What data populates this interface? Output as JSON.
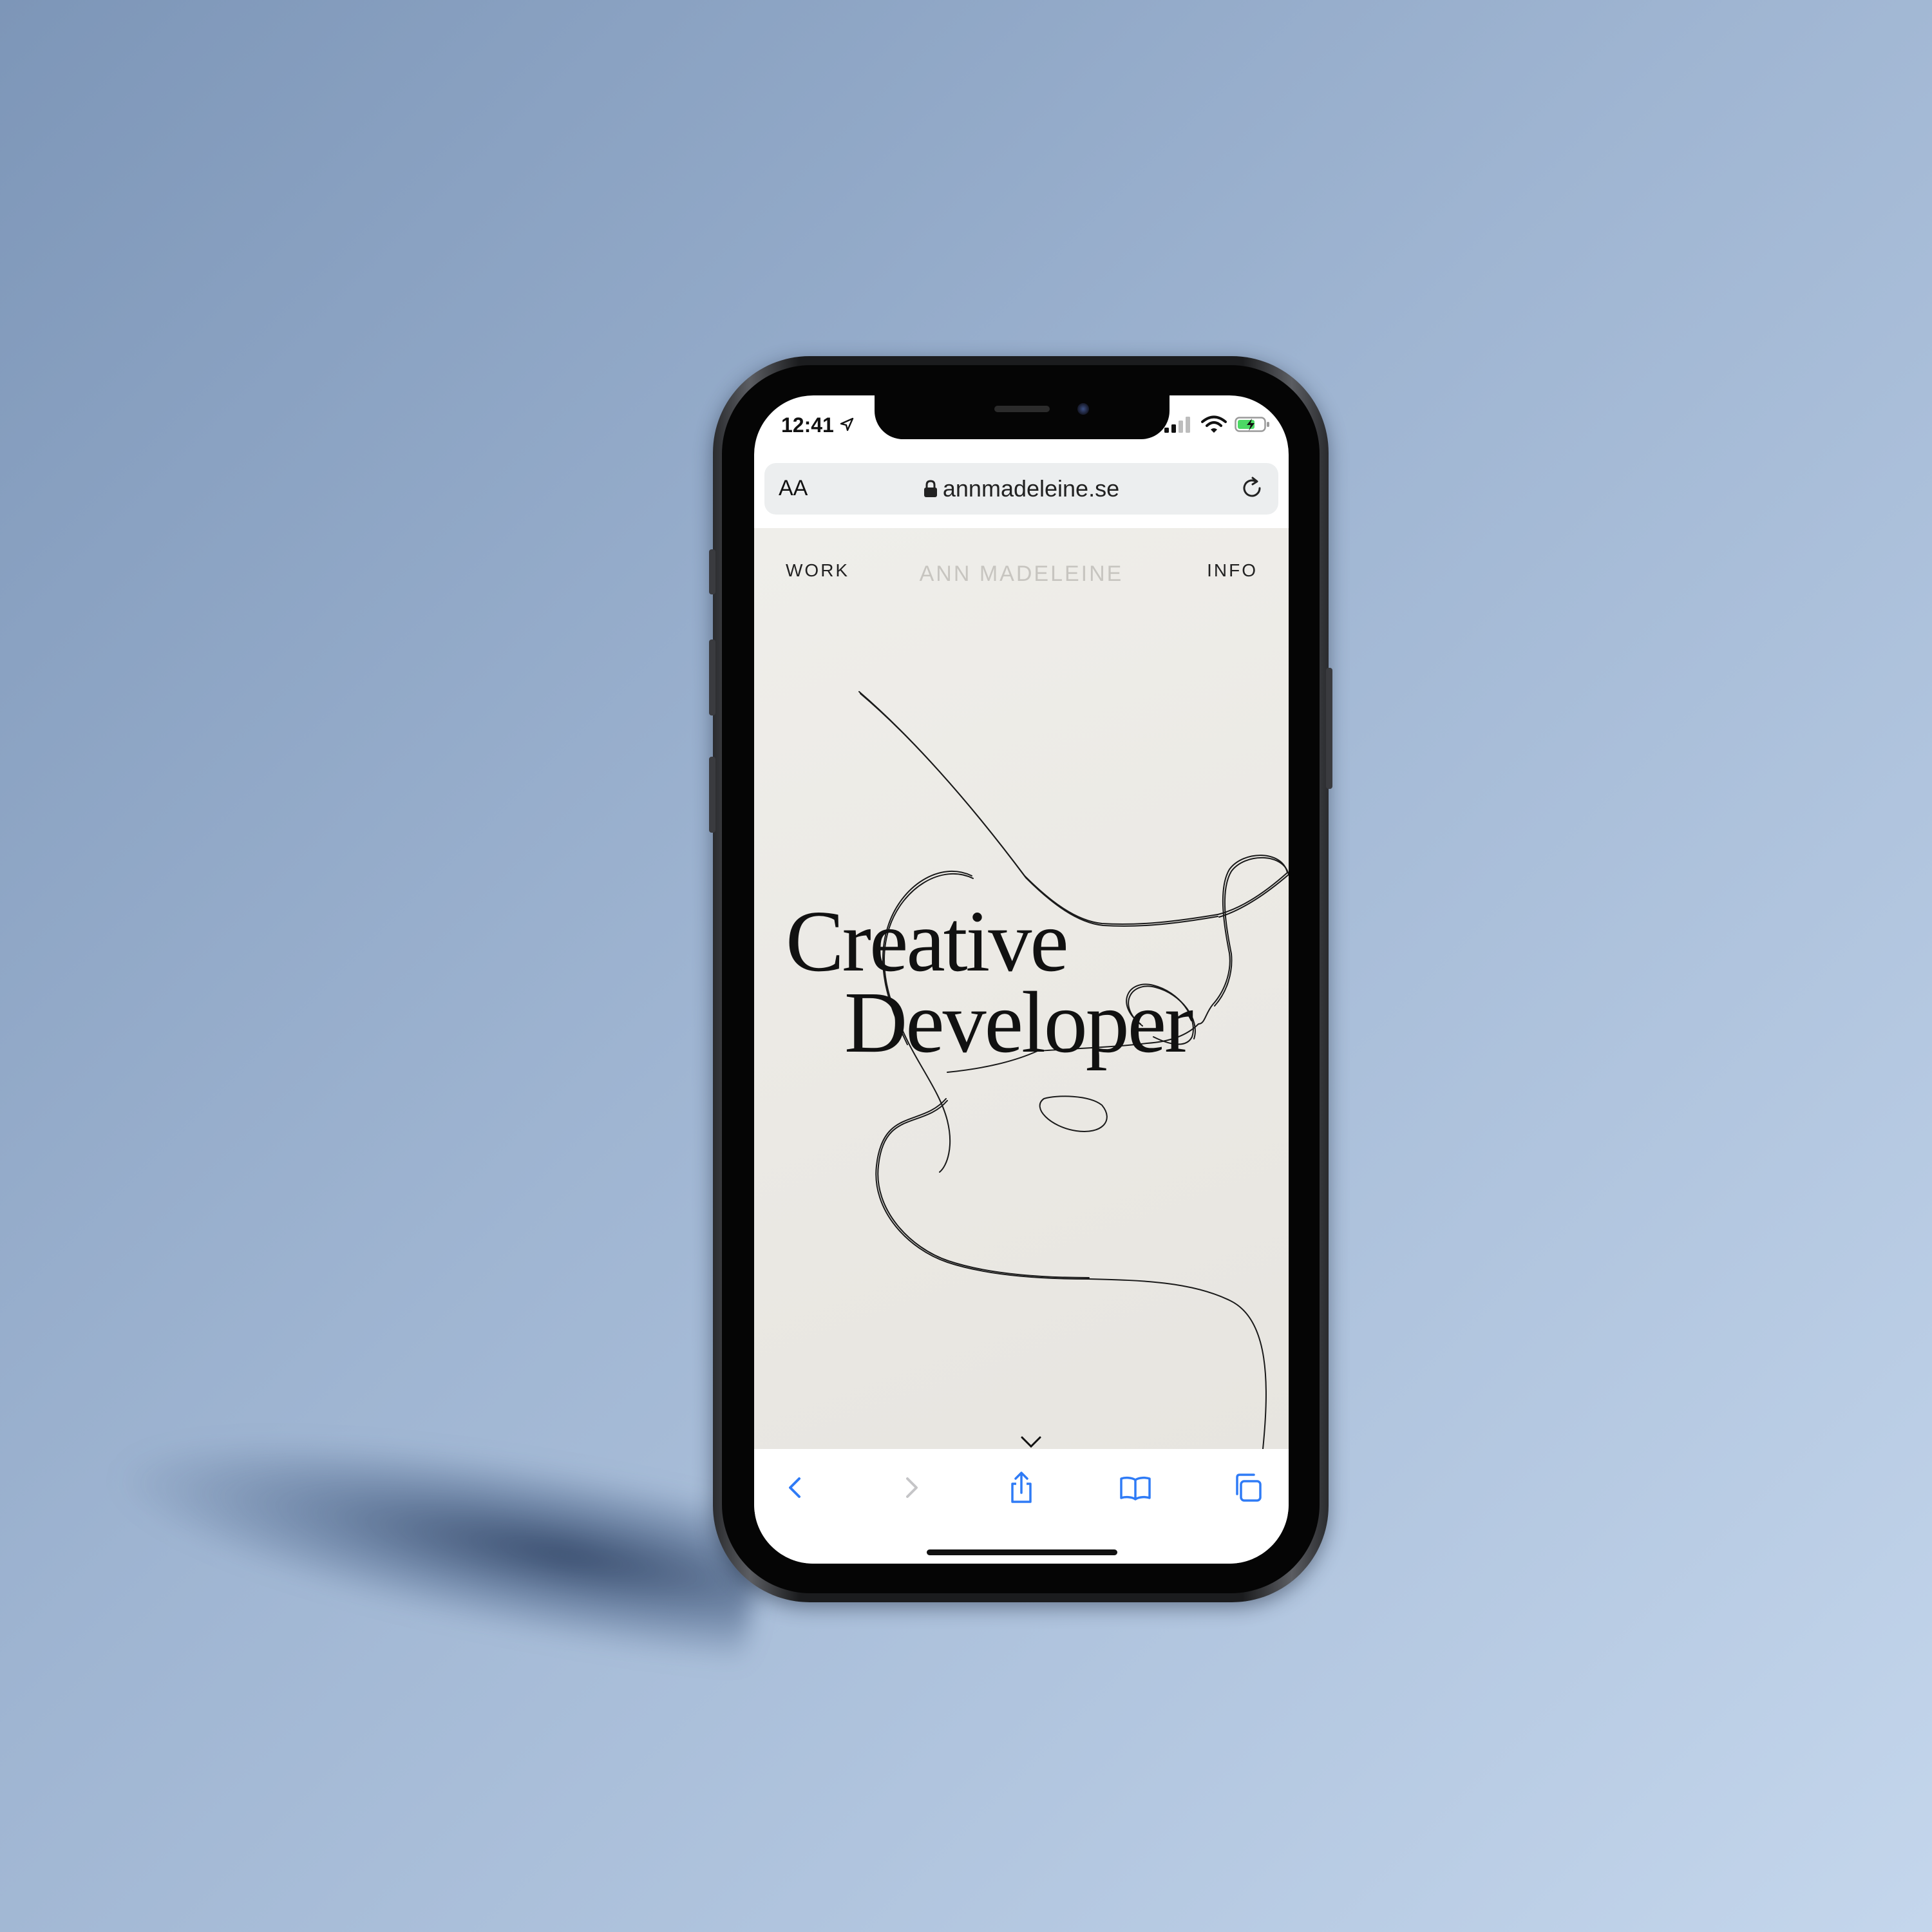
{
  "status_bar": {
    "time": "12:41"
  },
  "browser": {
    "text_size_button": "AA",
    "url": "annmadeleine.se"
  },
  "website": {
    "nav_left": "WORK",
    "brand": "ANN MADELEINE",
    "nav_right": "INFO",
    "hero_line_1": "Creative",
    "hero_line_2": "Developer"
  },
  "toolbar": {
    "icons": [
      "back-icon",
      "forward-icon",
      "share-icon",
      "bookmarks-icon",
      "tabs-icon"
    ]
  },
  "colors": {
    "background": "#9fb5d2",
    "page_background": "#ebe9e4",
    "accent_blue": "#2f7bf6",
    "brand_gray": "#c7c5c0"
  }
}
